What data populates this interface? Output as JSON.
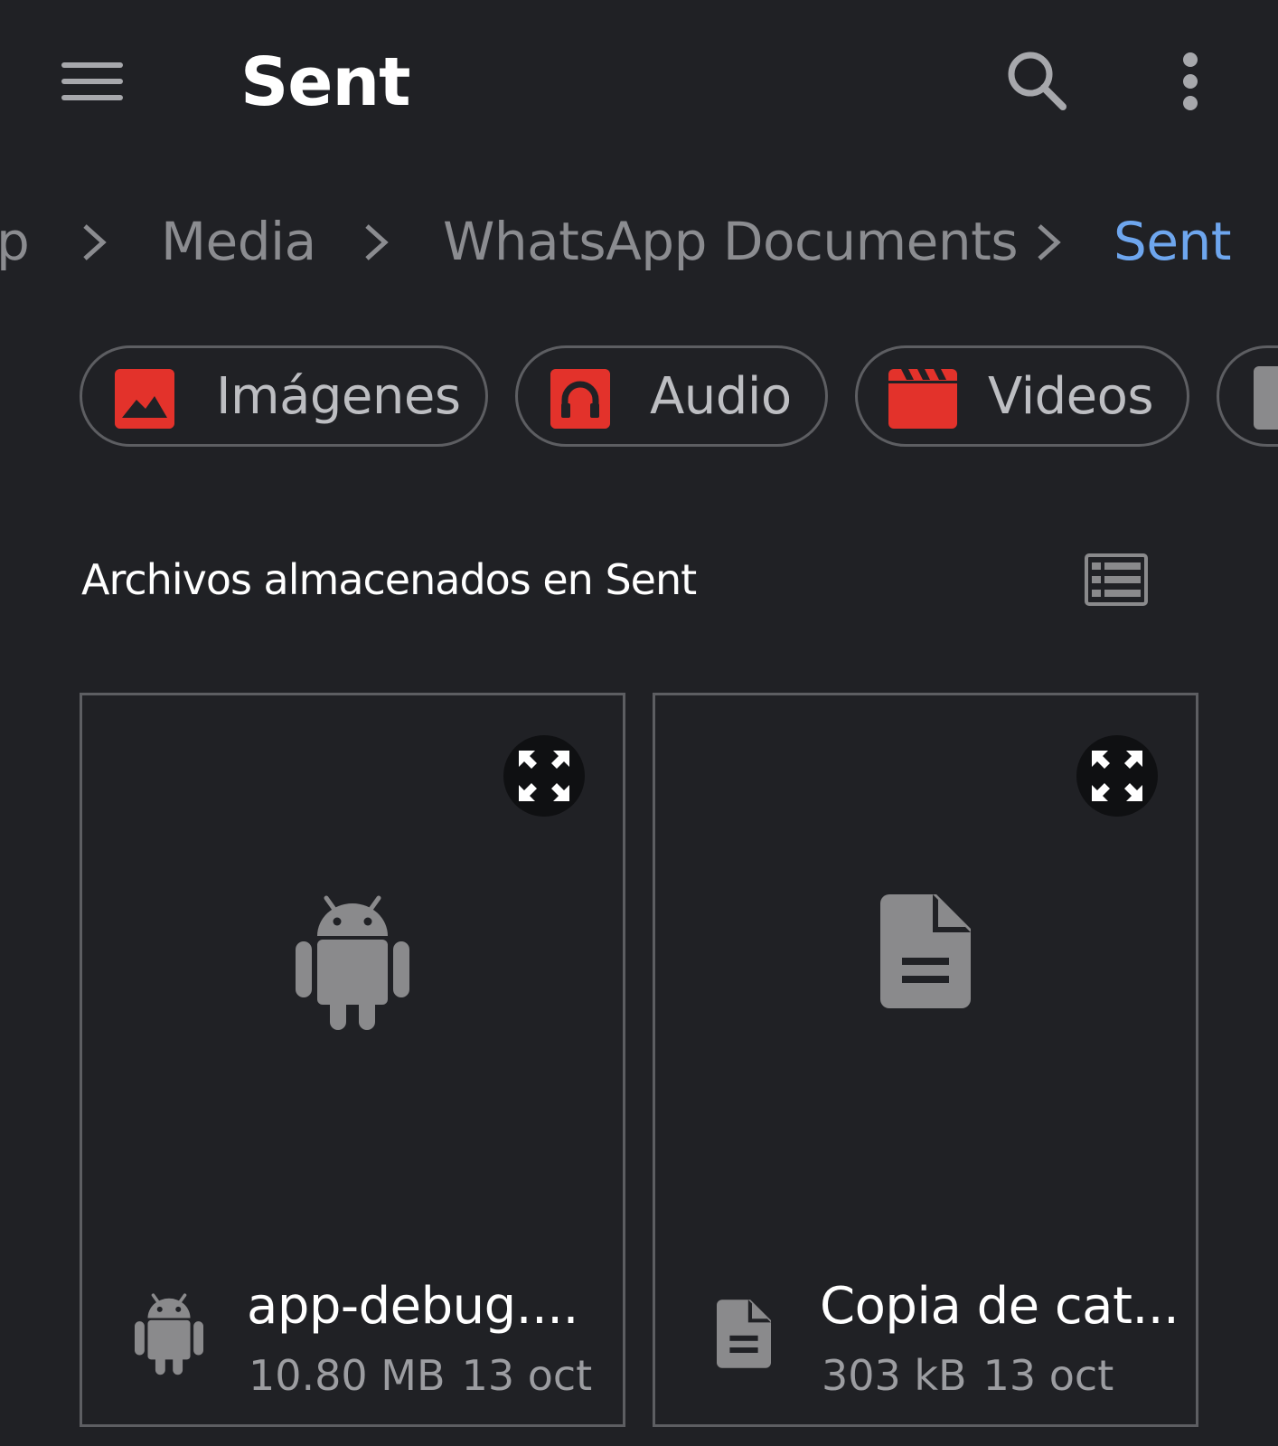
{
  "header": {
    "title": "Sent"
  },
  "breadcrumb": {
    "items": [
      "p",
      "Media",
      "WhatsApp Documents",
      "Sent"
    ]
  },
  "categories": [
    {
      "label": "Imágenes",
      "icon": "image-icon"
    },
    {
      "label": "Audio",
      "icon": "headphones-icon"
    },
    {
      "label": "Videos",
      "icon": "clapperboard-icon"
    }
  ],
  "section": {
    "title": "Archivos almacenados en Sent"
  },
  "files": [
    {
      "name": "app-debug....",
      "size": "10.80 MB",
      "date": "13 oct",
      "icon": "android-icon"
    },
    {
      "name": "Copia de cat...",
      "size": "303 kB",
      "date": "13 oct",
      "icon": "document-icon"
    }
  ],
  "colors": {
    "background": "#202125",
    "accent": "#6ea6ee",
    "category_icon": "#e3322b",
    "muted_icon": "#8a8a8c"
  }
}
